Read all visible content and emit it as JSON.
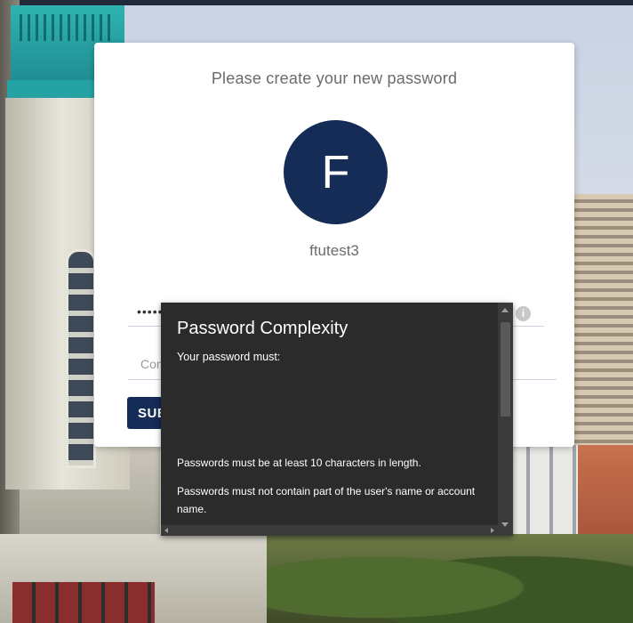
{
  "dialog": {
    "title": "Please create your new password",
    "avatar_initial": "F",
    "username": "ftutest3",
    "password_value": "•••••••",
    "info_icon": "i",
    "confirm_placeholder": "Confirm password",
    "submit_label": "SUBMIT"
  },
  "tooltip": {
    "title": "Password Complexity",
    "subtitle": "Your password must:",
    "rules": [
      "Passwords must be at least 10 characters in length.",
      "Passwords must not contain part of the user's name or account name."
    ]
  },
  "colors": {
    "accent": "#152c57",
    "tooltip_bg": "#2b2b2b",
    "card_bg": "#ffffff"
  },
  "icons": {
    "info": "info-icon",
    "scroll_up": "scroll-up-arrow-icon",
    "scroll_down": "scroll-down-arrow-icon"
  }
}
